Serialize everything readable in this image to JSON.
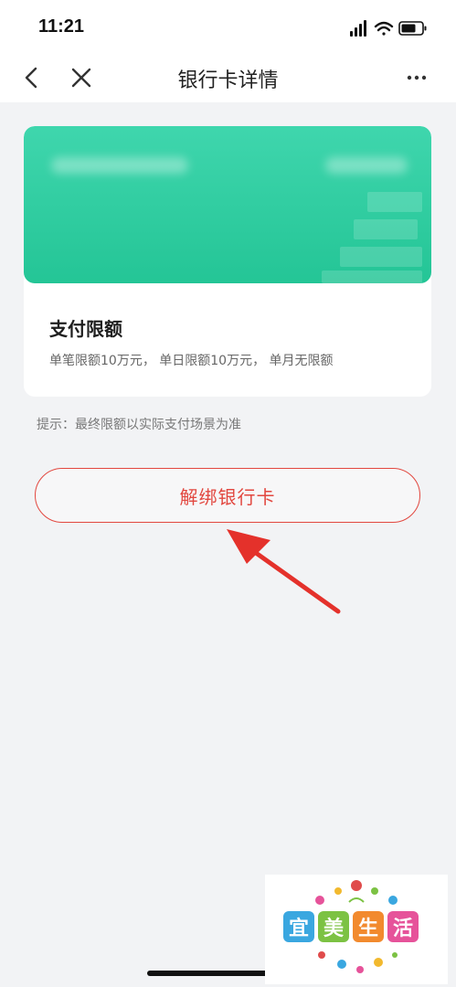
{
  "status_bar": {
    "time": "11:21"
  },
  "navbar": {
    "title": "银行卡详情",
    "back_icon": "chevron-left-icon",
    "close_icon": "close-icon",
    "more_icon": "more-horizontal-icon"
  },
  "card": {
    "color_top": "#3fd6ad",
    "color_bottom": "#24c596"
  },
  "limits": {
    "title": "支付限额",
    "description": "单笔限额10万元， 单日限额10万元， 单月无限额"
  },
  "hint": "提示：最终限额以实际支付场景为准",
  "unbind_button": {
    "label": "解绑银行卡",
    "color": "#e2473f"
  },
  "watermark_logo": {
    "chars": [
      "宜",
      "美",
      "生",
      "活"
    ],
    "colors": [
      "#3aa7e0",
      "#7cc243",
      "#f28a2e",
      "#e6539a"
    ]
  }
}
